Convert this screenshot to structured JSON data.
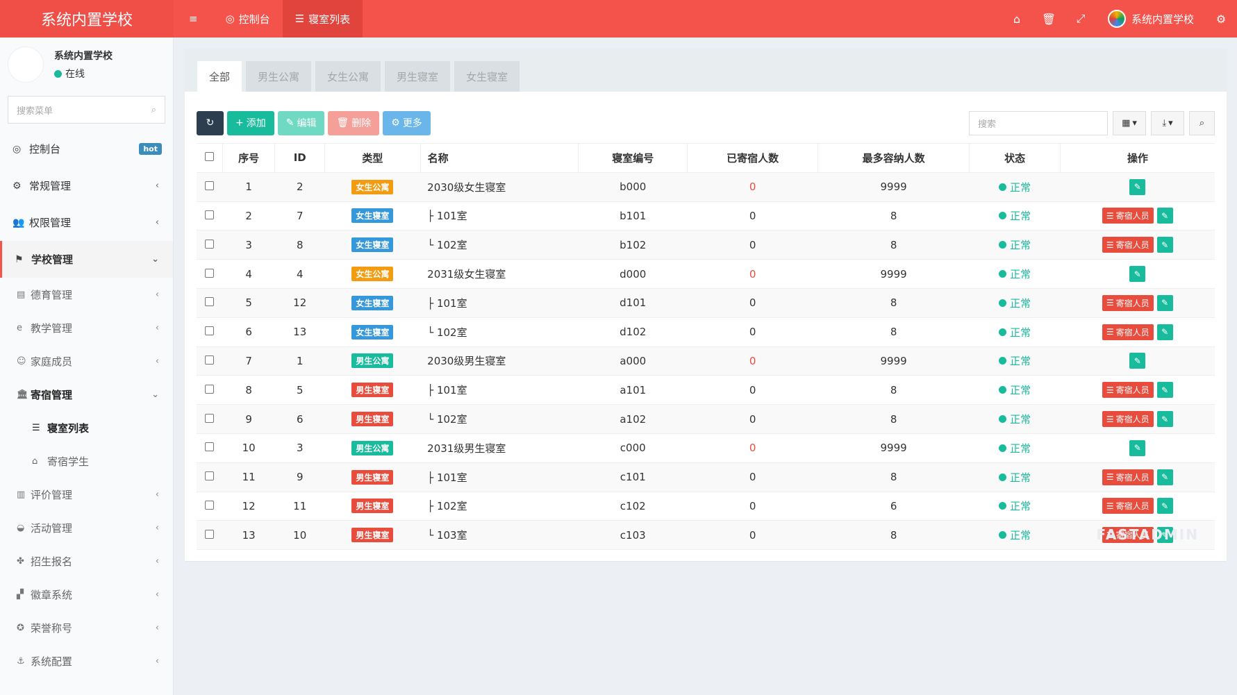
{
  "header": {
    "logo": "系统内置学校",
    "nav": [
      {
        "label": "控制台",
        "icon": "dashboard-icon",
        "glyph": "◎"
      },
      {
        "label": "寝室列表",
        "icon": "database-icon",
        "glyph": "☰"
      }
    ],
    "user_name": "系统内置学校"
  },
  "sidebar": {
    "profile_name": "系统内置学校",
    "profile_status": "在线",
    "search_placeholder": "搜索菜单",
    "hot_badge": "hot",
    "menu": {
      "dashboard": "控制台",
      "general": "常规管理",
      "permission": "权限管理",
      "school": "学校管理",
      "moral": "德育管理",
      "teaching": "教学管理",
      "family": "家庭成员",
      "dorm": "寄宿管理",
      "dorm_list": "寝室列表",
      "boarders": "寄宿学生",
      "evaluation": "评价管理",
      "activity": "活动管理",
      "enroll": "招生报名",
      "badge": "徽章系统",
      "honor": "荣誉称号",
      "config": "系统配置"
    }
  },
  "tabs": [
    "全部",
    "男生公寓",
    "女生公寓",
    "男生寝室",
    "女生寝室"
  ],
  "toolbar": {
    "add": "添加",
    "edit": "编辑",
    "delete": "删除",
    "more": "更多",
    "search_placeholder": "搜索"
  },
  "table": {
    "headers": [
      "序号",
      "ID",
      "类型",
      "名称",
      "寝室编号",
      "已寄宿人数",
      "最多容纳人数",
      "状态",
      "操作"
    ],
    "status_label": "正常",
    "op_label": "寄宿人员",
    "rows": [
      {
        "no": "1",
        "id": "2",
        "type": "女生公寓",
        "type_color": "#f39c12",
        "name": "2030级女生寝室",
        "code": "b000",
        "boarded": "0",
        "boarded_red": true,
        "max": "9999",
        "has_members": false
      },
      {
        "no": "2",
        "id": "7",
        "type": "女生寝室",
        "type_color": "#3498db",
        "name": "├ 101室",
        "code": "b101",
        "boarded": "0",
        "boarded_red": false,
        "max": "8",
        "has_members": true
      },
      {
        "no": "3",
        "id": "8",
        "type": "女生寝室",
        "type_color": "#3498db",
        "name": "└ 102室",
        "code": "b102",
        "boarded": "0",
        "boarded_red": false,
        "max": "8",
        "has_members": true
      },
      {
        "no": "4",
        "id": "4",
        "type": "女生公寓",
        "type_color": "#f39c12",
        "name": "2031级女生寝室",
        "code": "d000",
        "boarded": "0",
        "boarded_red": true,
        "max": "9999",
        "has_members": false
      },
      {
        "no": "5",
        "id": "12",
        "type": "女生寝室",
        "type_color": "#3498db",
        "name": "├ 101室",
        "code": "d101",
        "boarded": "0",
        "boarded_red": false,
        "max": "8",
        "has_members": true
      },
      {
        "no": "6",
        "id": "13",
        "type": "女生寝室",
        "type_color": "#3498db",
        "name": "└ 102室",
        "code": "d102",
        "boarded": "0",
        "boarded_red": false,
        "max": "8",
        "has_members": true
      },
      {
        "no": "7",
        "id": "1",
        "type": "男生公寓",
        "type_color": "#18bc9c",
        "name": "2030级男生寝室",
        "code": "a000",
        "boarded": "0",
        "boarded_red": true,
        "max": "9999",
        "has_members": false
      },
      {
        "no": "8",
        "id": "5",
        "type": "男生寝室",
        "type_color": "#e74c3c",
        "name": "├ 101室",
        "code": "a101",
        "boarded": "0",
        "boarded_red": false,
        "max": "8",
        "has_members": true
      },
      {
        "no": "9",
        "id": "6",
        "type": "男生寝室",
        "type_color": "#e74c3c",
        "name": "└ 102室",
        "code": "a102",
        "boarded": "0",
        "boarded_red": false,
        "max": "8",
        "has_members": true
      },
      {
        "no": "10",
        "id": "3",
        "type": "男生公寓",
        "type_color": "#18bc9c",
        "name": "2031级男生寝室",
        "code": "c000",
        "boarded": "0",
        "boarded_red": true,
        "max": "9999",
        "has_members": false
      },
      {
        "no": "11",
        "id": "9",
        "type": "男生寝室",
        "type_color": "#e74c3c",
        "name": "├ 101室",
        "code": "c101",
        "boarded": "0",
        "boarded_red": false,
        "max": "8",
        "has_members": true
      },
      {
        "no": "12",
        "id": "11",
        "type": "男生寝室",
        "type_color": "#e74c3c",
        "name": "├ 102室",
        "code": "c102",
        "boarded": "0",
        "boarded_red": false,
        "max": "6",
        "has_members": true
      },
      {
        "no": "13",
        "id": "10",
        "type": "男生寝室",
        "type_color": "#e74c3c",
        "name": "└ 103室",
        "code": "c103",
        "boarded": "0",
        "boarded_red": false,
        "max": "8",
        "has_members": true
      }
    ]
  },
  "watermark": "FASTADMIN",
  "colors": {
    "header": "#f4534b",
    "success": "#18bc9c",
    "danger": "#e74c3c",
    "primary_dark": "#2c3e50"
  }
}
